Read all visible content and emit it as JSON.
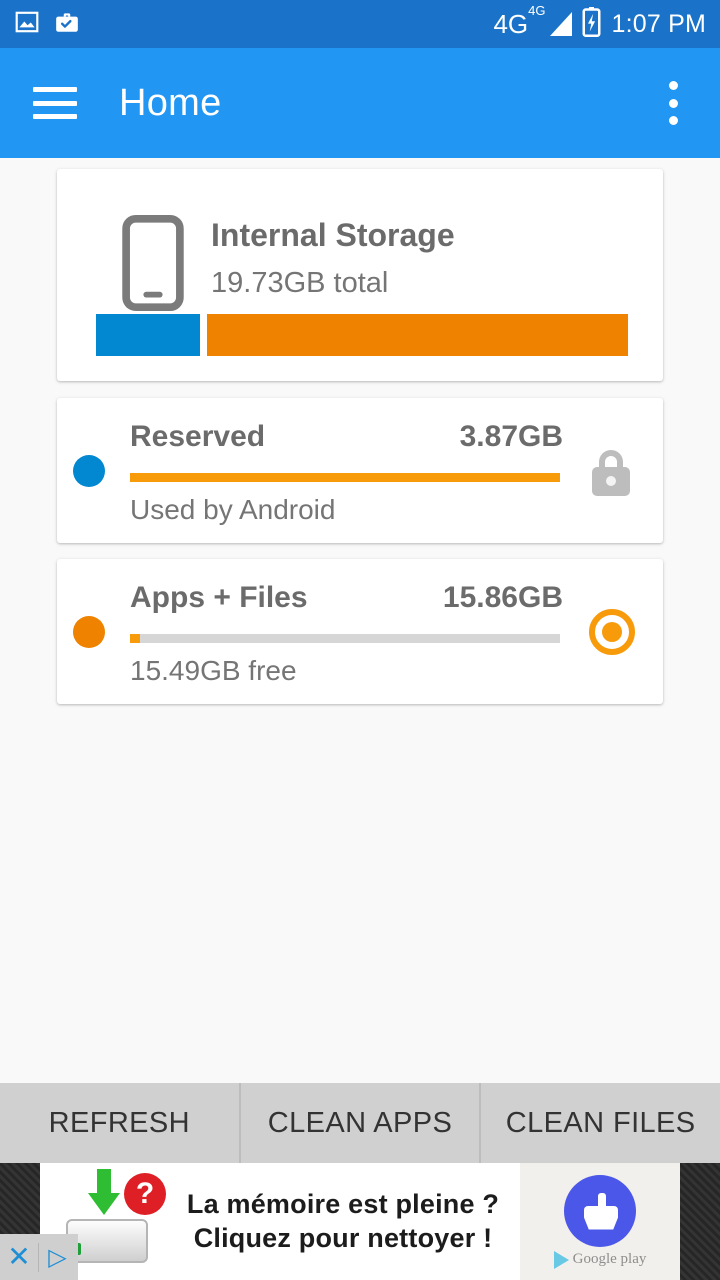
{
  "statusbar": {
    "icons": [
      "image-icon",
      "briefcase-check-icon"
    ],
    "network_primary": "4G",
    "network_secondary": "4G",
    "signal_icon": "signal-bars-icon",
    "battery_icon": "battery-charging-icon",
    "time": "1:07 PM",
    "background": "#1a73c8"
  },
  "appbar": {
    "menu_icon": "hamburger-menu-icon",
    "title": "Home",
    "overflow_icon": "overflow-menu-icon",
    "background": "#2196f3"
  },
  "storage_card": {
    "device_icon": "smartphone-icon",
    "title": "Internal Storage",
    "subtitle": "19.73GB total",
    "segments": [
      {
        "name": "reserved",
        "percent": 19.6,
        "color": "#0288d1"
      },
      {
        "name": "apps-files",
        "percent": 79.2,
        "color": "#ef8300"
      }
    ]
  },
  "rows": [
    {
      "id": "reserved",
      "dot_color": "#0288d1",
      "title": "Reserved",
      "size": "3.87GB",
      "subtitle": "Used by Android",
      "fill_percent": 100,
      "fill_color": "#f79b0b",
      "track_color": "#d6d6d6",
      "right_icon": "lock-icon"
    },
    {
      "id": "apps-files",
      "dot_color": "#ef8300",
      "title": "Apps + Files",
      "size": "15.86GB",
      "subtitle": "15.49GB free",
      "fill_percent": 2.3,
      "fill_color": "#f79b0b",
      "track_color": "#d6d6d6",
      "right_icon": "radio-selected-icon"
    }
  ],
  "buttonbar": {
    "buttons": [
      {
        "id": "refresh",
        "label": "REFRESH"
      },
      {
        "id": "clean-apps",
        "label": "CLEAN APPS"
      },
      {
        "id": "clean-files",
        "label": "CLEAN FILES"
      }
    ]
  },
  "ad": {
    "headline": "La mémoire est pleine ?",
    "subline": "Cliquez pour nettoyer !",
    "art_icon": "disk-download-question-icon",
    "cta_icon": "broom-icon",
    "store_badge": "Google play",
    "close_label": "✕",
    "adchoices_label": "▷"
  }
}
